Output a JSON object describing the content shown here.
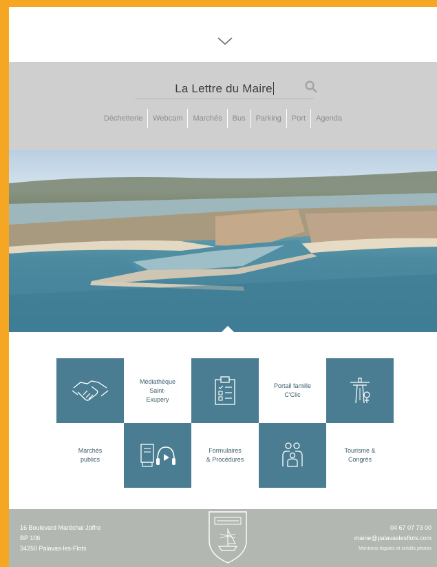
{
  "search": {
    "value": "La Lettre du Maire"
  },
  "quick_links": [
    "Déchetterie",
    "Webcam",
    "Marchés",
    "Bus",
    "Parking",
    "Port",
    "Agenda"
  ],
  "services": {
    "mediatheque": "Médiathèque\nSaint-\nExupery",
    "portail": "Portail famille\nC'Clic",
    "marches": "Marchés\npublics",
    "formulaires": "Formulaires\n& Procédures",
    "tourisme": "Tourisme &\nCongrès"
  },
  "footer": {
    "address_line1": "16 Boulevard Maréchal Joffre",
    "address_line2": "BP 106",
    "address_line3": "34250 Palavas-les-Flots",
    "phone": "04 67 07 73 00",
    "email": "mairie@palavaslesflots.com",
    "legal": "Mentions légales et crédits photos"
  },
  "colors": {
    "frame": "#f5a623",
    "tile": "#4a7d91",
    "footer": "#b3b7b1",
    "search_band": "#cfcfcf"
  }
}
